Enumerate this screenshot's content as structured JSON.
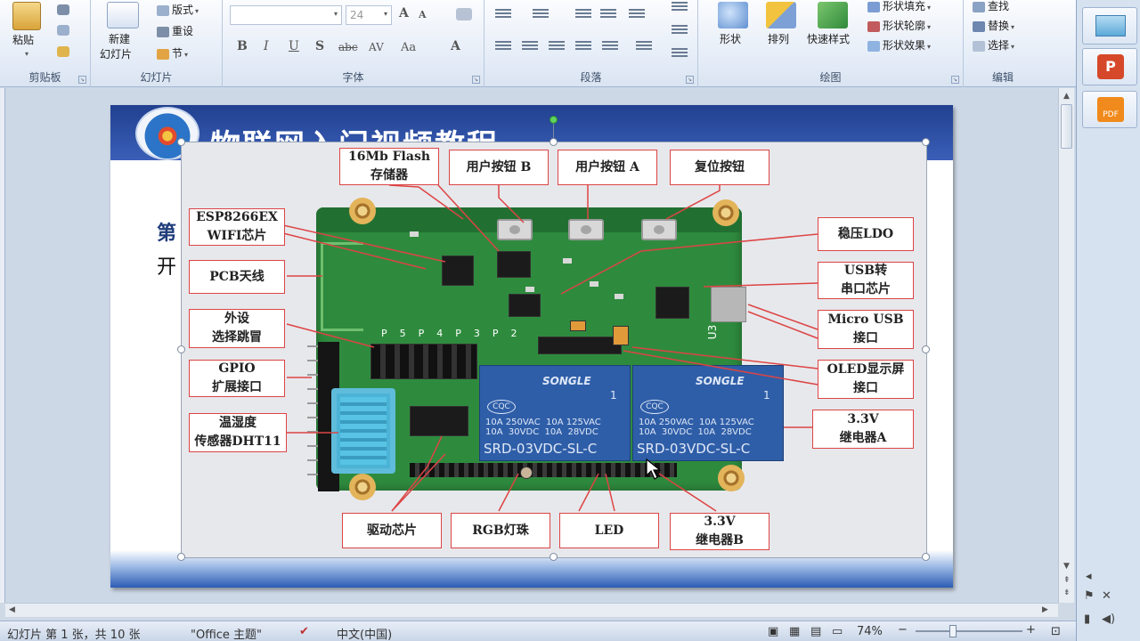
{
  "ribbon": {
    "clipboard": {
      "paste": "粘贴",
      "label": "剪贴板"
    },
    "slides": {
      "new_slide_line1": "新建",
      "new_slide_line2": "幻灯片",
      "layout": "版式",
      "reset": "重设",
      "section": "节",
      "label": "幻灯片"
    },
    "font": {
      "font_size": "24",
      "bold": "B",
      "italic": "I",
      "underline": "U",
      "shadow": "S",
      "strike": "abc",
      "spacing": "AV",
      "case": "Aa",
      "color": "A",
      "grow": "A",
      "shrink": "A",
      "label": "字体"
    },
    "paragraph": {
      "label": "段落"
    },
    "drawing": {
      "shapes": "形状",
      "arrange": "排列",
      "quick_styles": "快速样式",
      "fill": "形状填充",
      "outline": "形状轮廓",
      "effects": "形状效果",
      "label": "绘图"
    },
    "editing": {
      "find": "查找",
      "replace": "替换",
      "select": "选择",
      "label": "编辑"
    }
  },
  "slide": {
    "title": "物联网入门视频教程",
    "side_text_1": "第",
    "side_text_2": "开"
  },
  "board": {
    "relay_brand": "SONGLE",
    "relay_number": "1",
    "relay_cqc": "CQC",
    "relay_spec": "10A 250VAC  10A 125VAC\n10A  30VDC  10A  28VDC",
    "relay_model": "SRD-03VDC-SL-C",
    "pin_labels": [
      "P5",
      "P4",
      "P3",
      "P2"
    ],
    "u3_label": "U3"
  },
  "callouts": {
    "flash": "16Mb Flash\n存储器",
    "user_btn_b": "用户按钮 B",
    "user_btn_a": "用户按钮 A",
    "reset_btn": "复位按钮",
    "esp": "ESP8266EX\nWIFI芯片",
    "ldo": "稳压LDO",
    "usb_uart": "USB转\n串口芯片",
    "pcb_antenna": "PCB天线",
    "micro_usb": "Micro USB\n接口",
    "jumper": "外设\n选择跳冒",
    "gpio": "GPIO\n扩展接口",
    "oled": "OLED显示屏\n接口",
    "dht": "温湿度\n传感器DHT11",
    "relay_a": "3.3V\n继电器A",
    "driver": "驱动芯片",
    "rgb": "RGB灯珠",
    "led": "LED",
    "relay_b": "3.3V\n继电器B"
  },
  "status": {
    "slide_info": "幻灯片 第 1 张，共 10 张",
    "theme": "\"Office 主题\"",
    "language": "中文(中国)",
    "zoom": "74%",
    "zoom_out": "−",
    "zoom_in": "+"
  },
  "colors": {
    "callout_border": "#dd4444",
    "pcb": "#2e8b3e",
    "relay": "#2f5ea8",
    "header": "#21408f"
  },
  "icons": [
    "paste-icon",
    "cut-icon",
    "copy-icon",
    "format-painter-icon",
    "new-slide-icon",
    "shapes-icon",
    "arrange-icon",
    "quick-styles-icon",
    "find-icon",
    "replace-icon",
    "select-icon",
    "folder-icon",
    "powerpoint-icon",
    "pdf-icon",
    "notes-icon",
    "normal-view-icon",
    "sorter-view-icon",
    "reading-view-icon",
    "slideshow-icon",
    "fit-icon"
  ]
}
